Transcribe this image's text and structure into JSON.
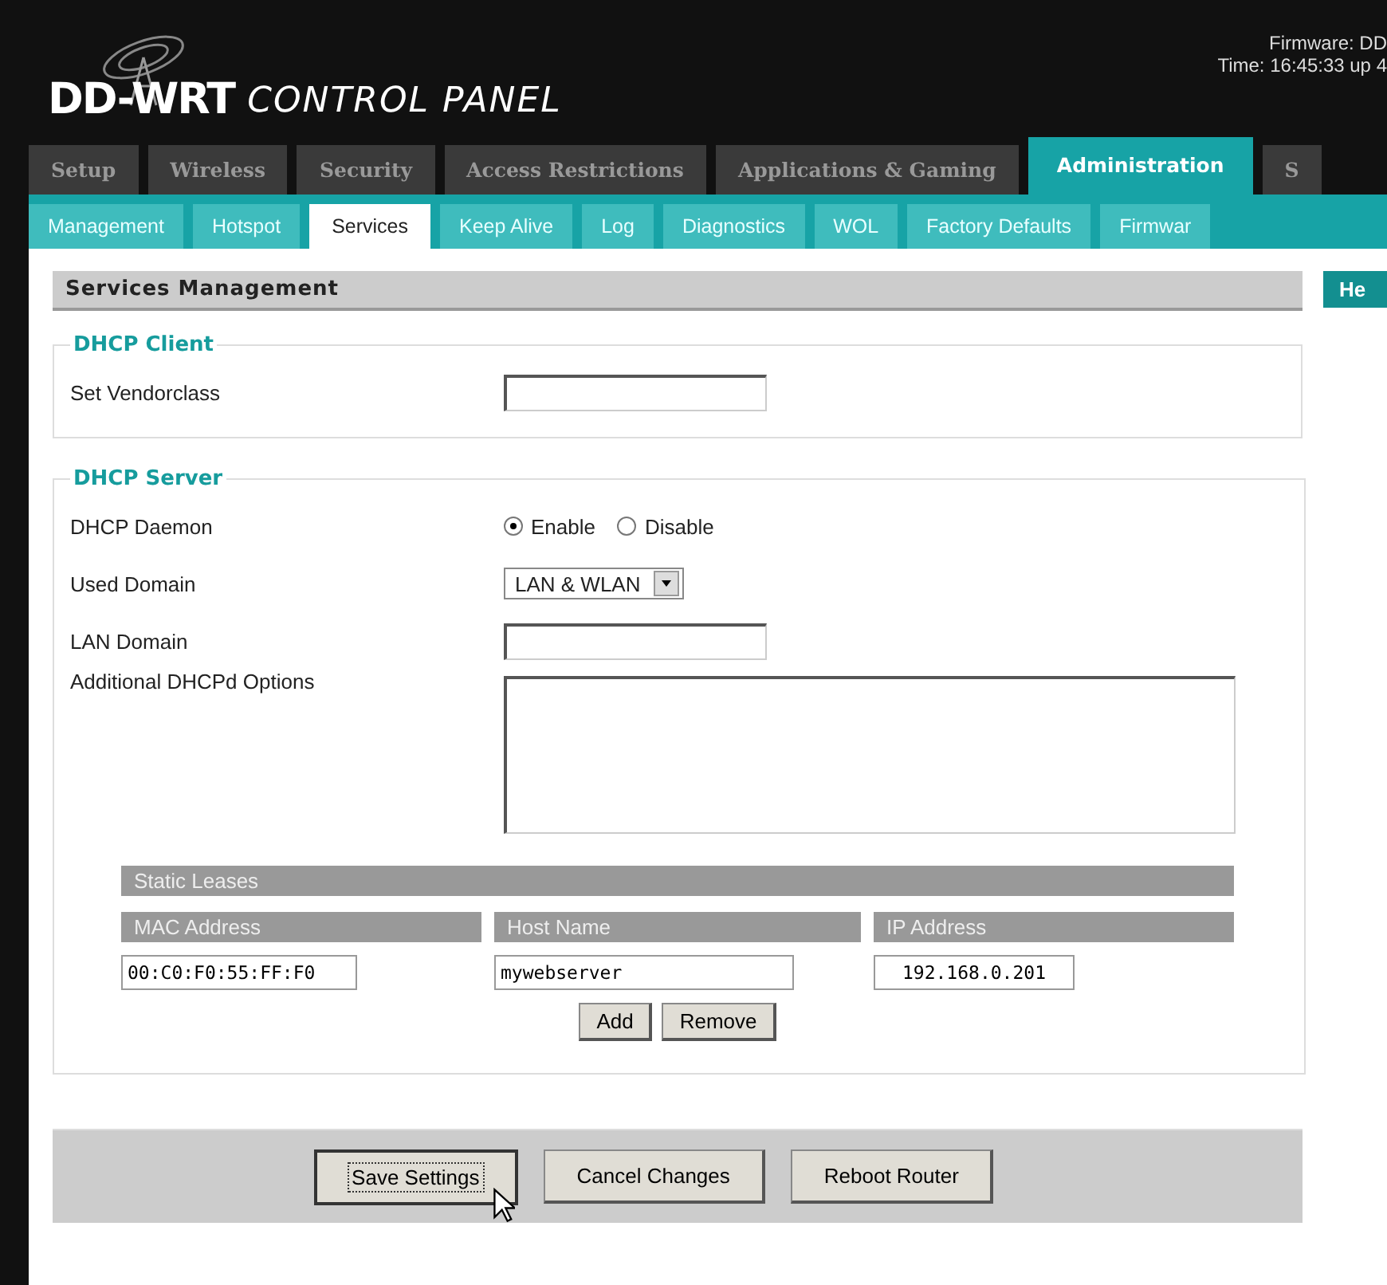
{
  "header": {
    "logo": "DD-WRT",
    "title": "CONTROL PANEL",
    "firmware": "Firmware: DD",
    "time": "Time: 16:45:33 up 4"
  },
  "tabs": [
    {
      "label": "Setup",
      "selected": false
    },
    {
      "label": "Wireless",
      "selected": false
    },
    {
      "label": "Security",
      "selected": false
    },
    {
      "label": "Access Restrictions",
      "selected": false
    },
    {
      "label": "Applications & Gaming",
      "selected": false
    },
    {
      "label": "Administration",
      "selected": true
    },
    {
      "label": "S",
      "selected": false
    }
  ],
  "subtabs": [
    {
      "label": "Management",
      "selected": false
    },
    {
      "label": "Hotspot",
      "selected": false
    },
    {
      "label": "Services",
      "selected": true
    },
    {
      "label": "Keep Alive",
      "selected": false
    },
    {
      "label": "Log",
      "selected": false
    },
    {
      "label": "Diagnostics",
      "selected": false
    },
    {
      "label": "WOL",
      "selected": false
    },
    {
      "label": "Factory Defaults",
      "selected": false
    },
    {
      "label": "Firmwar",
      "selected": false
    }
  ],
  "section_title": "Services Management",
  "help": "He",
  "dhcp_client": {
    "legend": "DHCP Client",
    "vendorclass_label": "Set Vendorclass"
  },
  "dhcp_server": {
    "legend": "DHCP Server",
    "daemon_label": "DHCP Daemon",
    "daemon_options": [
      {
        "label": "Enable",
        "selected": true
      },
      {
        "label": "Disable",
        "selected": false
      }
    ],
    "used_domain_label": "Used Domain",
    "used_domain": "LAN & WLAN",
    "lan_domain_label": "LAN Domain",
    "options_label": "Additional DHCPd Options",
    "static_leases": {
      "title": "Static Leases",
      "columns": [
        "MAC Address",
        "Host Name",
        "IP Address"
      ],
      "row": [
        "00:C0:F0:55:FF:F0",
        "mywebserver",
        "192.168.0.201"
      ],
      "buttons": [
        "Add",
        "Remove"
      ]
    }
  },
  "footer_buttons": [
    {
      "label": "Save Settings",
      "focused": true
    },
    {
      "label": "Cancel Changes",
      "focused": false
    },
    {
      "label": "Reboot Router",
      "focused": false
    }
  ]
}
